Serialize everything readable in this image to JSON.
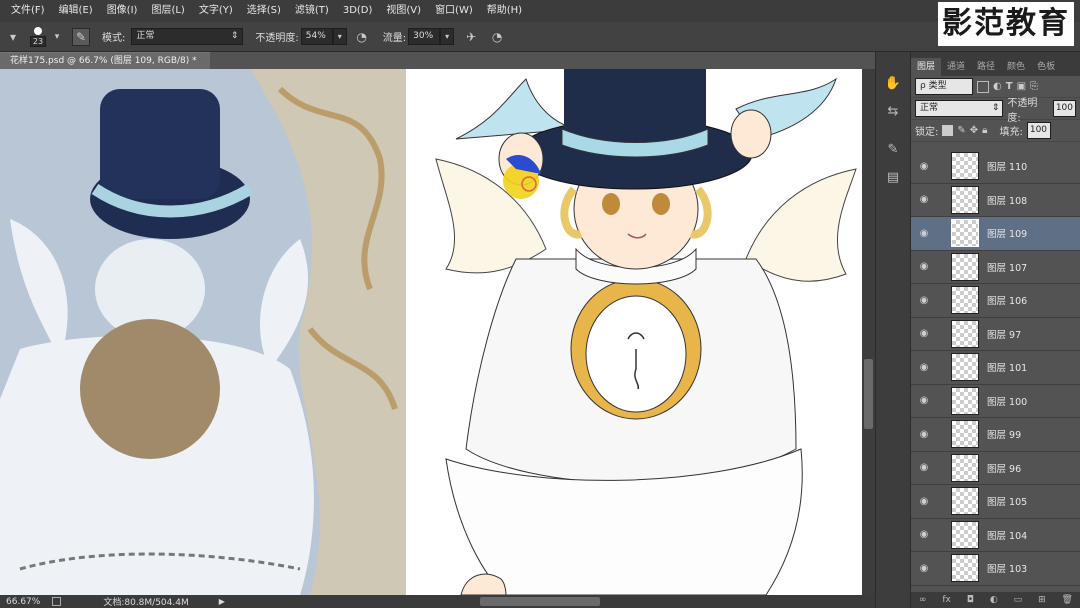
{
  "menu": [
    "文件(F)",
    "编辑(E)",
    "图像(I)",
    "图层(L)",
    "文字(Y)",
    "选择(S)",
    "滤镜(T)",
    "3D(D)",
    "视图(V)",
    "窗口(W)",
    "帮助(H)"
  ],
  "brand": "影范教育",
  "options": {
    "brush_size": "23",
    "mode_label": "模式:",
    "mode_value": "正常",
    "opacity_label": "不透明度:",
    "opacity_value": "54%",
    "flow_label": "流量:",
    "flow_value": "30%"
  },
  "document": {
    "tab_title": "花样175.psd @ 66.7% (图层 109, RGB/8) *",
    "zoom": "66.67%",
    "doc_info": "文档:80.8M/504.4M"
  },
  "panel": {
    "tabs": [
      "图层",
      "通道",
      "路径",
      "颜色",
      "色板"
    ],
    "filter_label": "ρ 类型",
    "blend_mode": "正常",
    "opacity_label": "不透明度:",
    "opacity_value": "100",
    "lock_label": "锁定:",
    "fill_label": "填充:",
    "fill_value": "100"
  },
  "layers": [
    {
      "name": "图层 110",
      "selected": false
    },
    {
      "name": "图层 108",
      "selected": false
    },
    {
      "name": "图层 109",
      "selected": true
    },
    {
      "name": "图层 107",
      "selected": false
    },
    {
      "name": "图层 106",
      "selected": false
    },
    {
      "name": "图层 97",
      "selected": false
    },
    {
      "name": "图层 101",
      "selected": false
    },
    {
      "name": "图层 100",
      "selected": false
    },
    {
      "name": "图层 99",
      "selected": false
    },
    {
      "name": "图层 96",
      "selected": false
    },
    {
      "name": "图层 105",
      "selected": false
    },
    {
      "name": "图层 104",
      "selected": false
    },
    {
      "name": "图层 103",
      "selected": false
    }
  ],
  "colors": {
    "selected_layer": "#5f6f86",
    "hat": "#1f2d4a",
    "ribbon": "#a9d8e6",
    "gold": "#e8b54a"
  }
}
